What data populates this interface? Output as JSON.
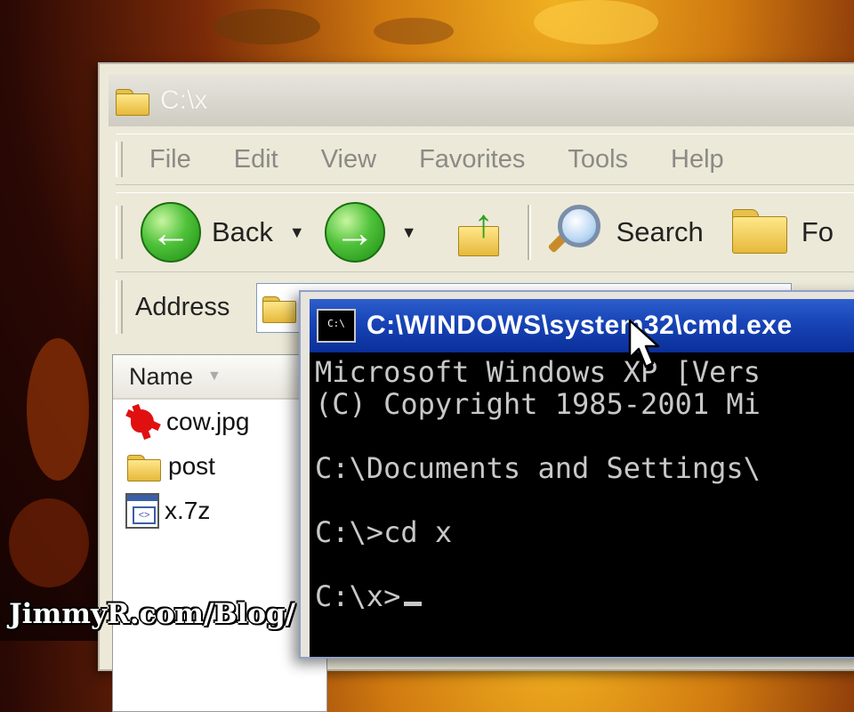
{
  "explorer": {
    "title": "C:\\x",
    "menu": [
      "File",
      "Edit",
      "View",
      "Favorites",
      "Tools",
      "Help"
    ],
    "toolbar": {
      "back_label": "Back",
      "search_label": "Search",
      "folders_label": "Fo"
    },
    "address": {
      "label": "Address"
    },
    "filelist": {
      "column_name": "Name",
      "files": [
        {
          "name": "cow.jpg",
          "icon": "jpg-file-icon"
        },
        {
          "name": "post",
          "icon": "folder-icon"
        },
        {
          "name": "x.7z",
          "icon": "7z-archive-icon"
        }
      ]
    }
  },
  "cmd": {
    "icon_text": "C:\\",
    "title": "C:\\WINDOWS\\system32\\cmd.exe",
    "lines": [
      "Microsoft Windows XP [Vers",
      "(C) Copyright 1985-2001 Mi",
      "",
      "C:\\Documents and Settings\\",
      "",
      "C:\\>cd x",
      "",
      "C:\\x>"
    ]
  },
  "watermark": "JimmyR.com/Blog/"
}
